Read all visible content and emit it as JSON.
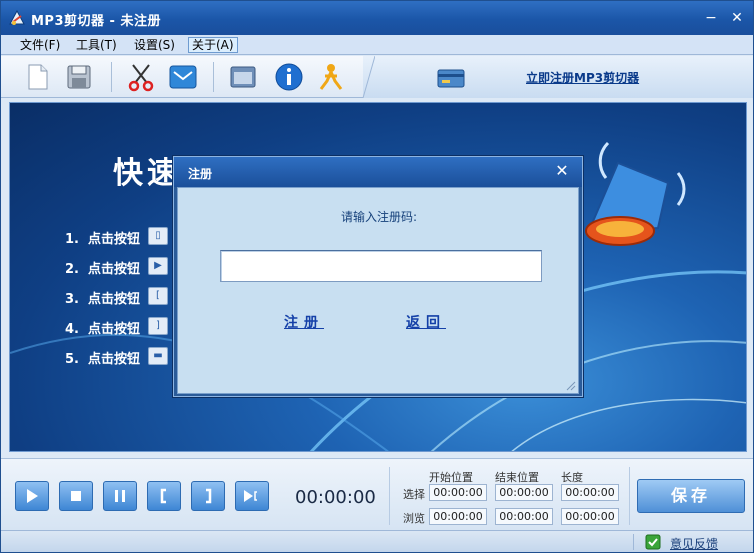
{
  "window": {
    "title": "MP3剪切器 - 未注册",
    "minimize_glyph": "−",
    "close_glyph": "✕"
  },
  "menu": {
    "items": [
      {
        "label": "文件(F)"
      },
      {
        "label": "工具(T)"
      },
      {
        "label": "设置(S)"
      },
      {
        "label": "关于(A)",
        "active": true
      }
    ]
  },
  "toolbar": {
    "icons": [
      "new-file-icon",
      "save-icon",
      "scissors-icon",
      "mail-icon",
      "window-icon",
      "info-icon",
      "qq-icon"
    ],
    "register_link": "立即注册MP3剪切器"
  },
  "main": {
    "quick_title": "快速开始",
    "steps": [
      {
        "num": "1.",
        "text": "点击按钮"
      },
      {
        "num": "2.",
        "text": "点击按钮"
      },
      {
        "num": "3.",
        "text": "点击按钮"
      },
      {
        "num": "4.",
        "text": "点击按钮"
      },
      {
        "num": "5.",
        "text": "点击按钮"
      }
    ]
  },
  "dialog": {
    "title": "注册",
    "prompt": "请输入注册码:",
    "input_value": "",
    "register_button": "注册",
    "back_button": "返回"
  },
  "controls": {
    "buttons": [
      "play-icon",
      "stop-icon",
      "pause-icon",
      "mark-start-icon",
      "mark-end-icon",
      "play-selection-icon"
    ],
    "current_time": "00:00:00",
    "headers": {
      "start": "开始位置",
      "end": "结束位置",
      "length": "长度"
    },
    "rows": [
      {
        "label": "选择",
        "start": "00:00:00",
        "end": "00:00:00",
        "length": "00:00:00"
      },
      {
        "label": "浏览",
        "start": "00:00:00",
        "end": "00:00:00",
        "length": "00:00:00"
      }
    ],
    "save_label": "保存"
  },
  "status": {
    "feedback": "意见反馈"
  },
  "colors": {
    "titlebar": "#1b56a8",
    "accent": "#2f6fc3",
    "link": "#1440a8"
  }
}
